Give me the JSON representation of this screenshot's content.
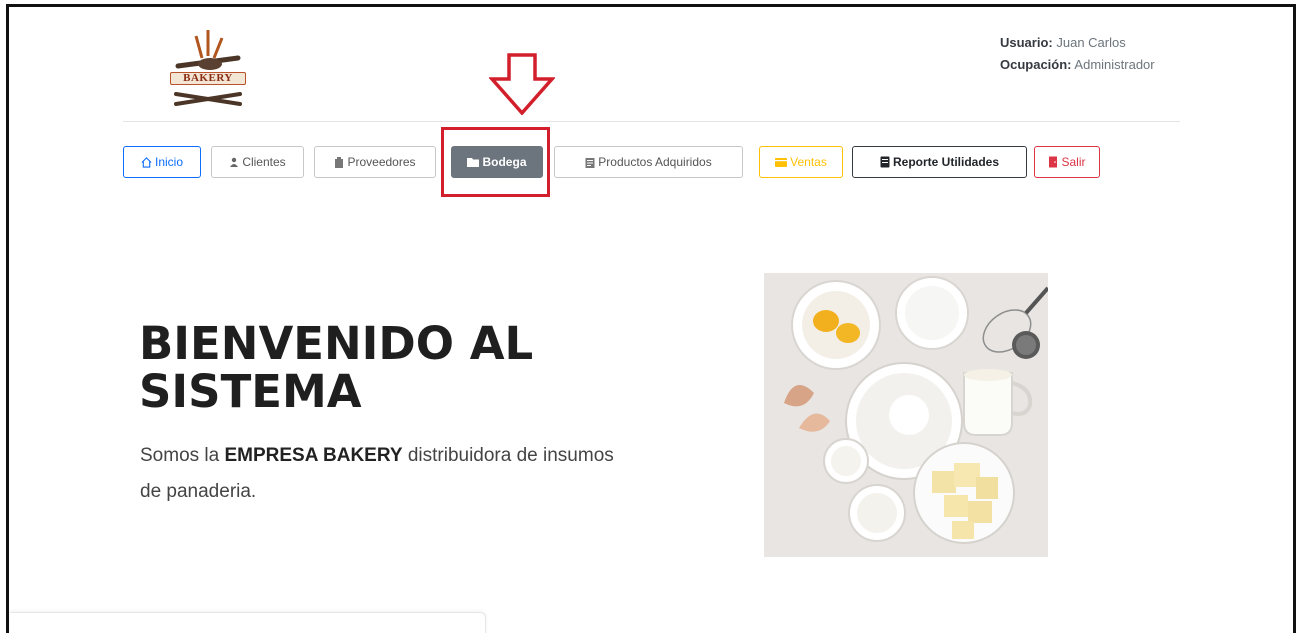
{
  "logo": {
    "text": "BAKERY"
  },
  "user": {
    "usuario_label": "Usuario:",
    "usuario_value": "Juan Carlos",
    "ocupacion_label": "Ocupación:",
    "ocupacion_value": "Administrador"
  },
  "nav": {
    "inicio": "Inicio",
    "clientes": "Clientes",
    "proveedores": "Proveedores",
    "bodega": "Bodega",
    "productos": "Productos Adquiridos",
    "ventas": "Ventas",
    "reporte": "Reporte Utilidades",
    "salir": "Salir"
  },
  "hero": {
    "title_line1": "BIENVENIDO AL",
    "title_line2": "SISTEMA",
    "text_prefix": "Somos la ",
    "text_bold": "EMPRESA BAKERY",
    "text_suffix": " distribuidora de insumos de panaderia."
  },
  "colors": {
    "primary": "#0d6efd",
    "secondary": "#6c757d",
    "warning": "#ffc107",
    "danger": "#dc3545",
    "dark": "#343a40",
    "annotation": "#d21f2b"
  }
}
